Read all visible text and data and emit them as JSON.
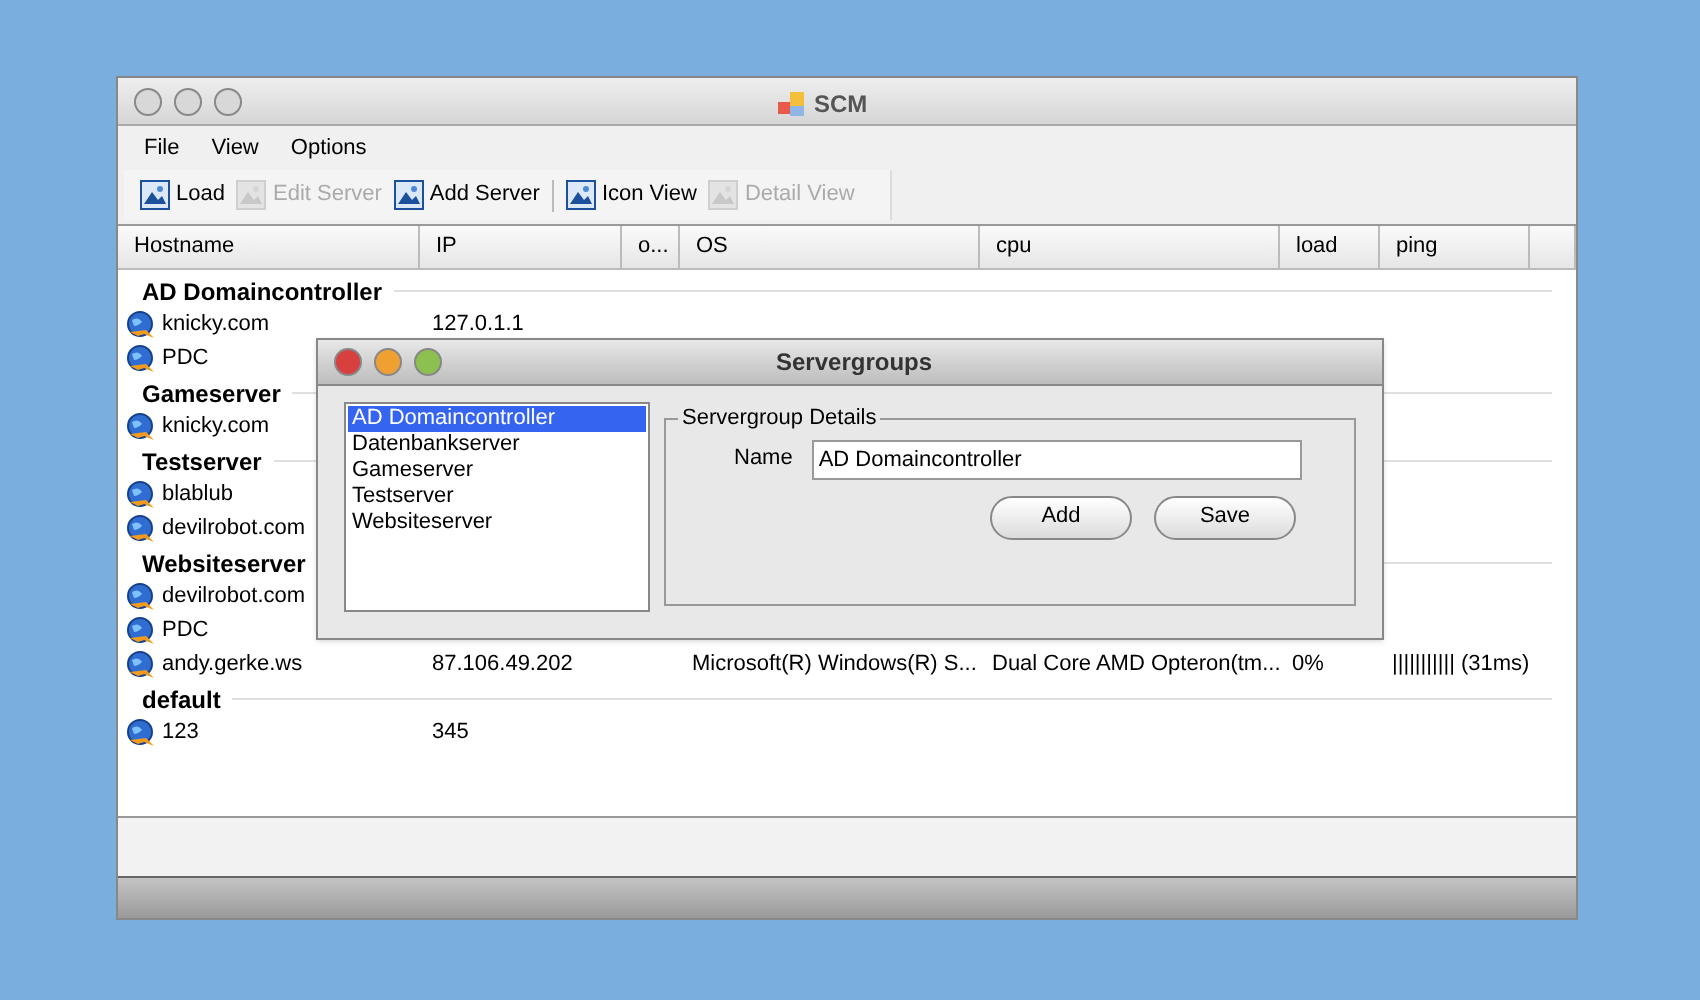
{
  "window": {
    "title": "SCM"
  },
  "menu": [
    "File",
    "View",
    "Options"
  ],
  "toolbar": [
    {
      "label": "Load",
      "disabled": false,
      "separator_before": false
    },
    {
      "label": "Edit Server",
      "disabled": true,
      "separator_before": false
    },
    {
      "label": "Add Server",
      "disabled": false,
      "separator_before": false
    },
    {
      "label": "Icon View",
      "disabled": false,
      "separator_before": true
    },
    {
      "label": "Detail View",
      "disabled": true,
      "separator_before": false
    }
  ],
  "table": {
    "columns": [
      "Hostname",
      "IP",
      "o...",
      "OS",
      "cpu",
      "load",
      "ping"
    ],
    "groups": [
      {
        "name": "AD Domaincontroller",
        "rows": [
          {
            "hostname": "knicky.com",
            "ip": "127.0.1.1"
          },
          {
            "hostname": "PDC"
          }
        ]
      },
      {
        "name": "Gameserver",
        "rows": [
          {
            "hostname": "knicky.com"
          }
        ]
      },
      {
        "name": "Testserver",
        "rows": [
          {
            "hostname": "blablub"
          },
          {
            "hostname": "devilrobot.com"
          }
        ]
      },
      {
        "name": "Websiteserver",
        "rows": [
          {
            "hostname": "devilrobot.com"
          },
          {
            "hostname": "PDC"
          },
          {
            "hostname": "andy.gerke.ws",
            "ip": "87.106.49.202",
            "os": "Microsoft(R) Windows(R) S...",
            "cpu": "Dual Core AMD Opteron(tm...",
            "load": "0%",
            "ping": "||||||||||| (31ms)"
          }
        ]
      },
      {
        "name": "default",
        "rows": [
          {
            "hostname": "123",
            "ip": "345"
          }
        ]
      }
    ]
  },
  "dialog": {
    "title": "Servergroups",
    "list": [
      {
        "label": "AD Domaincontroller",
        "selected": true
      },
      {
        "label": "Datenbankserver",
        "selected": false
      },
      {
        "label": "Gameserver",
        "selected": false
      },
      {
        "label": "Testserver",
        "selected": false
      },
      {
        "label": "Websiteserver",
        "selected": false
      }
    ],
    "details": {
      "legend": "Servergroup Details",
      "name_label": "Name",
      "name_value": "AD Domaincontroller",
      "buttons": [
        "Add",
        "Save"
      ]
    }
  }
}
